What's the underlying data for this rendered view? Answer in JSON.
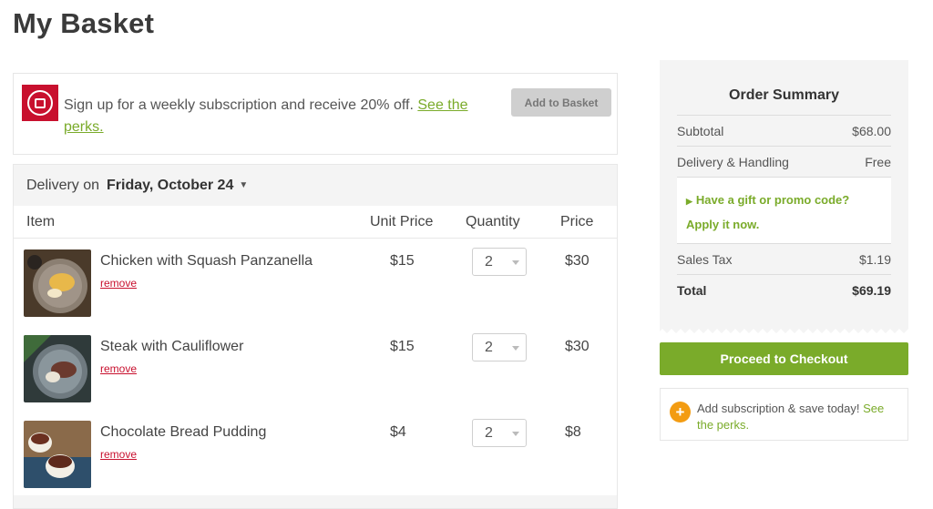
{
  "page": {
    "title": "My Basket"
  },
  "promo": {
    "text": "Sign up for a weekly subscription and receive 20% off.",
    "link": "See the perks.",
    "add_button": "Add to Basket"
  },
  "basket": {
    "delivery_label": "Delivery on",
    "delivery_date": "Friday, October 24",
    "columns": {
      "item": "Item",
      "unit_price": "Unit Price",
      "quantity": "Quantity",
      "price": "Price"
    },
    "remove_label": "remove",
    "items": [
      {
        "name": "Chicken with Squash Panzanella",
        "unit_price": "$15",
        "quantity": "2",
        "price": "$30"
      },
      {
        "name": "Steak with Cauliflower",
        "unit_price": "$15",
        "quantity": "2",
        "price": "$30"
      },
      {
        "name": "Chocolate Bread Pudding",
        "unit_price": "$4",
        "quantity": "2",
        "price": "$8"
      }
    ]
  },
  "summary": {
    "title": "Order Summary",
    "subtotal_label": "Subtotal",
    "subtotal_value": "$68.00",
    "delivery_label": "Delivery & Handling",
    "delivery_value": "Free",
    "promo_question": "Have a gift or promo code?",
    "promo_action": "Apply it now.",
    "tax_label": "Sales Tax",
    "tax_value": "$1.19",
    "total_label": "Total",
    "total_value": "$69.19"
  },
  "checkout": {
    "label": "Proceed to Checkout"
  },
  "subscription_card": {
    "text": "Add subscription & save today!",
    "link": "See the perks."
  },
  "colors": {
    "accent_green": "#7aab2a",
    "brand_red": "#c8102e",
    "plus_orange": "#f39c12"
  },
  "icons": {
    "brand_badge": "subscription-box-icon",
    "delivery_caret": "caret-down-icon",
    "quantity_arrow": "chevron-down-icon",
    "promo_arrow": "triangle-right-icon",
    "add_subscription": "plus-circle-icon"
  }
}
